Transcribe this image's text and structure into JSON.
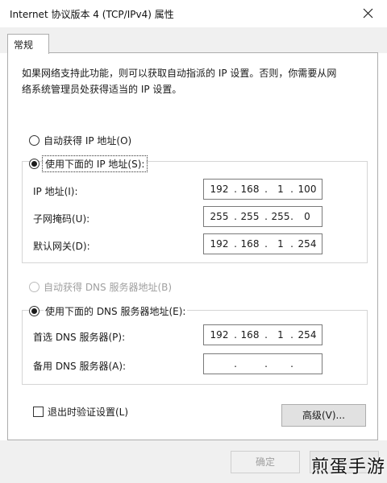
{
  "window": {
    "title": "Internet 协议版本 4 (TCP/IPv4) 属性"
  },
  "tabs": [
    {
      "label": "常规"
    }
  ],
  "description": {
    "line1": "如果网络支持此功能，则可以获取自动指派的 IP 设置。否则，你需要从网",
    "line2": "络系统管理员处获得适当的 IP 设置。"
  },
  "ip_section": {
    "auto_option": "自动获得 IP 地址(O)",
    "manual_option": "使用下面的 IP 地址(S):",
    "selected": "manual",
    "fields": [
      {
        "label": "IP 地址(I):",
        "octets": [
          "192",
          "168",
          "1",
          "100"
        ]
      },
      {
        "label": "子网掩码(U):",
        "octets": [
          "255",
          "255",
          "255",
          "0"
        ]
      },
      {
        "label": "默认网关(D):",
        "octets": [
          "192",
          "168",
          "1",
          "254"
        ]
      }
    ]
  },
  "dns_section": {
    "auto_option": "自动获得 DNS 服务器地址(B)",
    "manual_option": "使用下面的 DNS 服务器地址(E):",
    "selected": "manual",
    "fields": [
      {
        "label": "首选 DNS 服务器(P):",
        "octets": [
          "192",
          "168",
          "1",
          "254"
        ]
      },
      {
        "label": "备用 DNS 服务器(A):",
        "octets": [
          "",
          "",
          "",
          ""
        ]
      }
    ]
  },
  "validate_on_exit": {
    "label": "退出时验证设置(L)",
    "checked": false
  },
  "buttons": {
    "advanced": "高级(V)...",
    "ok": "确定"
  },
  "watermark": "煎蛋手游"
}
